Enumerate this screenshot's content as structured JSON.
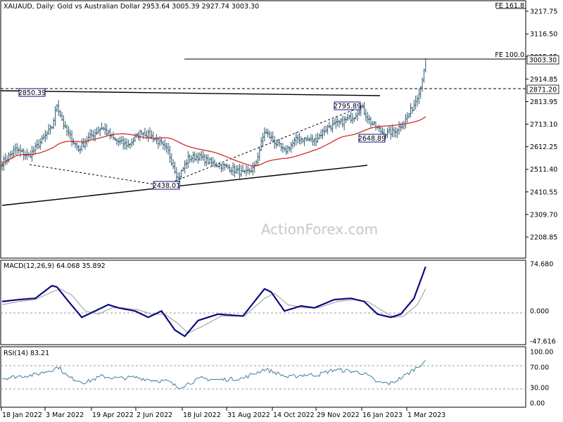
{
  "header": {
    "main": "XAUAUD, Daily:  Gold vs Australian Dollar  2953.64 3005.39 2927.74 3003.30",
    "macd": "MACD(12,26,9) 64.068 35.892",
    "rsi": "RSI(14) 83.21"
  },
  "watermark": "ActionForex.com",
  "colors": {
    "bar": "#2d5a6e",
    "sma": "#d42a2a",
    "macd": "#0b0b80",
    "signal": "#a8a8a8",
    "rsi": "#3e7f96",
    "guide": "#9a9a9a",
    "frame": "#000000"
  },
  "chart_data": [
    {
      "type": "ohlc",
      "name": "price",
      "y_ticks": [
        "3217.75",
        "3116.50",
        "3015.15",
        "2914.85",
        "2813.95",
        "2713.10",
        "2612.25",
        "2511.40",
        "2410.55",
        "2309.70",
        "2208.85"
      ],
      "price_labels": [
        "3003.30",
        "2871.20"
      ],
      "fib_labels": [
        "FE 161.8",
        "FE 100.0"
      ],
      "annotations": [
        "2850.39",
        "2795.89",
        "2648.89",
        "2438.01"
      ],
      "x_ticks": [
        "18 Jan 2022",
        "3 Mar 2022",
        "19 Apr 2022",
        "2 Jun 2022",
        "18 Jul 2022",
        "31 Aug 2022",
        "14 Oct 2022",
        "29 Nov 2022",
        "16 Jan 2023",
        "1 Mar 2023"
      ],
      "ylim": [
        2140,
        3245
      ],
      "close_anchors": [
        [
          0,
          2540
        ],
        [
          8,
          2600
        ],
        [
          16,
          2570
        ],
        [
          24,
          2640
        ],
        [
          30,
          2700
        ],
        [
          33,
          2800
        ],
        [
          38,
          2690
        ],
        [
          46,
          2600
        ],
        [
          52,
          2650
        ],
        [
          60,
          2700
        ],
        [
          68,
          2640
        ],
        [
          76,
          2620
        ],
        [
          84,
          2680
        ],
        [
          92,
          2650
        ],
        [
          100,
          2590
        ],
        [
          106,
          2470
        ],
        [
          112,
          2560
        ],
        [
          118,
          2570
        ],
        [
          126,
          2540
        ],
        [
          136,
          2520
        ],
        [
          146,
          2490
        ],
        [
          152,
          2520
        ],
        [
          158,
          2680
        ],
        [
          162,
          2650
        ],
        [
          170,
          2590
        ],
        [
          178,
          2650
        ],
        [
          188,
          2640
        ],
        [
          196,
          2700
        ],
        [
          204,
          2720
        ],
        [
          212,
          2750
        ],
        [
          216,
          2790
        ],
        [
          222,
          2720
        ],
        [
          230,
          2670
        ],
        [
          236,
          2680
        ],
        [
          242,
          2720
        ],
        [
          248,
          2800
        ],
        [
          252,
          2880
        ],
        [
          255,
          3003
        ]
      ]
    },
    {
      "type": "line",
      "name": "macd",
      "y_ticks": [
        "74.680",
        "0.000",
        "-47.616"
      ],
      "ylim": [
        -49,
        78
      ],
      "macd_anchors": [
        [
          0,
          15
        ],
        [
          10,
          18
        ],
        [
          20,
          20
        ],
        [
          30,
          40
        ],
        [
          33,
          38
        ],
        [
          40,
          15
        ],
        [
          48,
          -10
        ],
        [
          56,
          0
        ],
        [
          64,
          10
        ],
        [
          70,
          5
        ],
        [
          80,
          0
        ],
        [
          88,
          -10
        ],
        [
          96,
          0
        ],
        [
          104,
          -30
        ],
        [
          110,
          -40
        ],
        [
          118,
          -15
        ],
        [
          130,
          -5
        ],
        [
          145,
          -8
        ],
        [
          158,
          35
        ],
        [
          162,
          30
        ],
        [
          170,
          0
        ],
        [
          180,
          8
        ],
        [
          188,
          5
        ],
        [
          200,
          18
        ],
        [
          210,
          20
        ],
        [
          218,
          15
        ],
        [
          226,
          -5
        ],
        [
          234,
          -10
        ],
        [
          240,
          -5
        ],
        [
          248,
          20
        ],
        [
          255,
          70
        ]
      ],
      "signal_anchors": [
        [
          0,
          10
        ],
        [
          10,
          15
        ],
        [
          20,
          18
        ],
        [
          30,
          30
        ],
        [
          35,
          35
        ],
        [
          42,
          25
        ],
        [
          50,
          0
        ],
        [
          58,
          -5
        ],
        [
          66,
          5
        ],
        [
          72,
          5
        ],
        [
          82,
          2
        ],
        [
          90,
          -5
        ],
        [
          98,
          -5
        ],
        [
          106,
          -20
        ],
        [
          112,
          -35
        ],
        [
          120,
          -25
        ],
        [
          132,
          -8
        ],
        [
          146,
          -8
        ],
        [
          158,
          20
        ],
        [
          164,
          28
        ],
        [
          172,
          10
        ],
        [
          182,
          5
        ],
        [
          190,
          5
        ],
        [
          202,
          15
        ],
        [
          212,
          18
        ],
        [
          220,
          15
        ],
        [
          228,
          2
        ],
        [
          236,
          -10
        ],
        [
          242,
          -8
        ],
        [
          250,
          10
        ],
        [
          255,
          35
        ]
      ]
    },
    {
      "type": "line",
      "name": "rsi",
      "y_ticks": [
        "100.00",
        "70.00",
        "30.00",
        "0.00"
      ],
      "ylim": [
        0,
        100
      ],
      "rsi_anchors": [
        [
          0,
          48
        ],
        [
          10,
          52
        ],
        [
          20,
          55
        ],
        [
          30,
          65
        ],
        [
          34,
          70
        ],
        [
          40,
          50
        ],
        [
          50,
          40
        ],
        [
          60,
          52
        ],
        [
          70,
          48
        ],
        [
          80,
          50
        ],
        [
          90,
          45
        ],
        [
          100,
          42
        ],
        [
          106,
          30
        ],
        [
          112,
          38
        ],
        [
          120,
          48
        ],
        [
          130,
          45
        ],
        [
          145,
          48
        ],
        [
          158,
          66
        ],
        [
          164,
          60
        ],
        [
          172,
          50
        ],
        [
          182,
          55
        ],
        [
          190,
          55
        ],
        [
          200,
          65
        ],
        [
          210,
          62
        ],
        [
          218,
          58
        ],
        [
          226,
          40
        ],
        [
          234,
          38
        ],
        [
          242,
          52
        ],
        [
          250,
          70
        ],
        [
          255,
          83
        ]
      ]
    }
  ]
}
